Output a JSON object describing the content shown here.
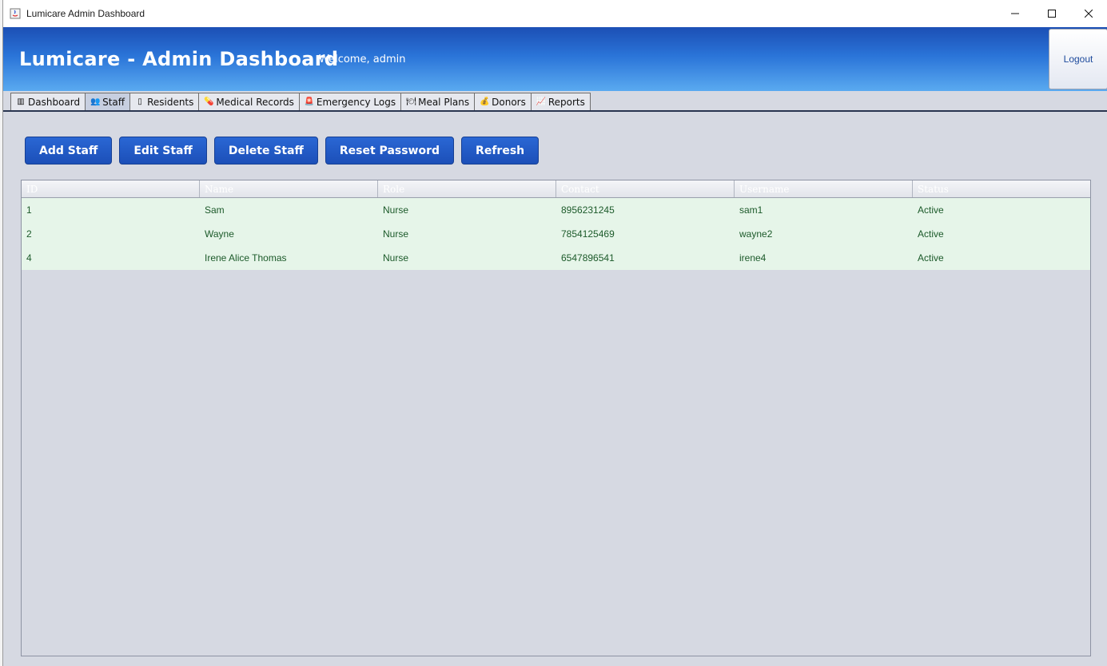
{
  "window": {
    "title": "Lumicare Admin Dashboard",
    "controls": {
      "minimize": "—",
      "maximize": "☐",
      "close": "✕"
    }
  },
  "header": {
    "title": "Lumicare - Admin Dashboard",
    "welcome": "Welcome, admin",
    "logout_label": "Logout"
  },
  "tabs": [
    {
      "label": "Dashboard",
      "icon": "dashboard-icon",
      "glyph": "▥",
      "active": false
    },
    {
      "label": "Staff",
      "icon": "staff-icon",
      "glyph": "👥",
      "active": true
    },
    {
      "label": "Residents",
      "icon": "residents-icon",
      "glyph": "▯",
      "active": false
    },
    {
      "label": "Medical Records",
      "icon": "pill-icon",
      "glyph": "💊",
      "active": false
    },
    {
      "label": "Emergency Logs",
      "icon": "emergency-icon",
      "glyph": "🚨",
      "active": false
    },
    {
      "label": "Meal Plans",
      "icon": "meal-icon",
      "glyph": "🍽",
      "active": false
    },
    {
      "label": "Donors",
      "icon": "donor-icon",
      "glyph": "💰",
      "active": false
    },
    {
      "label": "Reports",
      "icon": "reports-icon",
      "glyph": "📈",
      "active": false
    }
  ],
  "toolbar": {
    "add": "Add Staff",
    "edit": "Edit Staff",
    "delete": "Delete Staff",
    "reset": "Reset Password",
    "refresh": "Refresh"
  },
  "table": {
    "columns": [
      "ID",
      "Name",
      "Role",
      "Contact",
      "Username",
      "Status"
    ],
    "rows": [
      [
        "1",
        "Sam",
        "Nurse",
        "8956231245",
        "sam1",
        "Active"
      ],
      [
        "2",
        "Wayne",
        "Nurse",
        "7854125469",
        "wayne2",
        "Active"
      ],
      [
        "4",
        "Irene Alice Thomas",
        "Nurse",
        "6547896541",
        "irene4",
        "Active"
      ]
    ]
  },
  "colors": {
    "header_start": "#1c4fb5",
    "header_end": "#5aaaf0",
    "button": "#1c4fb8",
    "row_bg": "#e6f5e9",
    "row_text": "#1c5a2a"
  }
}
